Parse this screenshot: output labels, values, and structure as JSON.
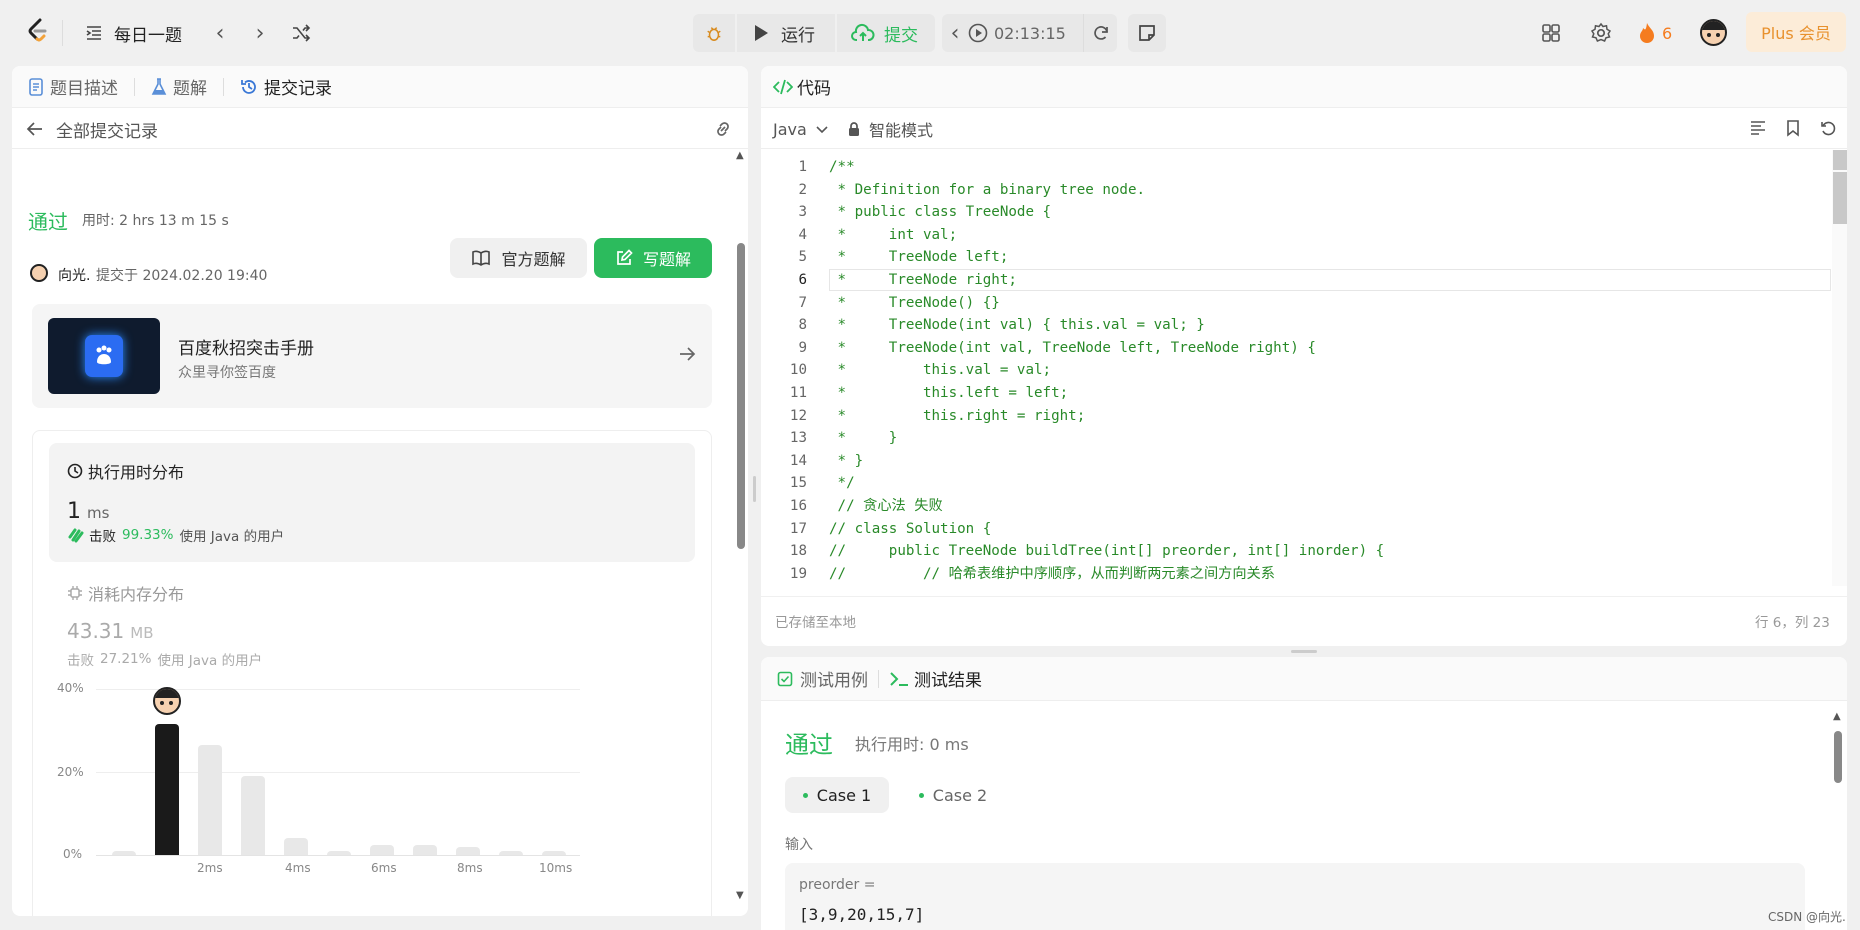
{
  "topbar": {
    "daily_label": "每日一题",
    "run_label": "运行",
    "submit_label": "提交",
    "timer": "02:13:15",
    "streak": "6",
    "plus_label": "Plus 会员"
  },
  "left": {
    "tabs": [
      "题目描述",
      "题解",
      "提交记录"
    ],
    "back_label": "全部提交记录",
    "status": "通过",
    "duration": "用时: 2 hrs 13 m 15 s",
    "user": "向光.",
    "submitted_at": "提交于 2024.02.20 19:40",
    "official_btn": "官方题解",
    "write_btn": "写题解",
    "ad_title": "百度秋招突击手册",
    "ad_sub": "众里寻你签百度",
    "runtime": {
      "title": "执行用时分布",
      "value": "1",
      "unit": "ms",
      "beat_prefix": "击败",
      "beat_pct": "99.33%",
      "beat_suffix": "使用 Java 的用户"
    },
    "memory": {
      "title": "消耗内存分布",
      "value": "43.31",
      "unit": "MB",
      "beat_prefix": "击败",
      "beat_pct": "27.21%",
      "beat_suffix": "使用 Java 的用户"
    }
  },
  "chart_data": {
    "type": "bar",
    "yticks": [
      "40%",
      "20%",
      "0%"
    ],
    "xticks": [
      "2ms",
      "4ms",
      "6ms",
      "8ms",
      "10ms"
    ],
    "ylim": [
      0,
      40
    ],
    "values": [
      1,
      31.5,
      26.5,
      19,
      4,
      1,
      2.5,
      2.5,
      2,
      1,
      1
    ],
    "highlight_index": 1,
    "colors": {
      "bar": "#e8e8e8",
      "highlight": "#1a1a1a"
    }
  },
  "editor": {
    "tab_label": "代码",
    "language": "Java",
    "mode": "智能模式",
    "saved": "已存储至本地",
    "cursor": "行 6，列 23",
    "lines": [
      "/**",
      " * Definition for a binary tree node.",
      " * public class TreeNode {",
      " *     int val;",
      " *     TreeNode left;",
      " *     TreeNode right;",
      " *     TreeNode() {}",
      " *     TreeNode(int val) { this.val = val; }",
      " *     TreeNode(int val, TreeNode left, TreeNode right) {",
      " *         this.val = val;",
      " *         this.left = left;",
      " *         this.right = right;",
      " *     }",
      " * }",
      " */",
      " // 贪心法 失败",
      "// class Solution {",
      "//     public TreeNode buildTree(int[] preorder, int[] inorder) {",
      "//         // 哈希表维护中序顺序，从而判断两元素之间方向关系"
    ],
    "line_numbers": [
      "1",
      "2",
      "3",
      "4",
      "5",
      "6",
      "7",
      "8",
      "9",
      "10",
      "11",
      "12",
      "13",
      "14",
      "15",
      "16",
      "17",
      "18",
      "19"
    ]
  },
  "result": {
    "tab_cases": "测试用例",
    "tab_result": "测试结果",
    "status": "通过",
    "time": "执行用时: 0 ms",
    "case1": "Case 1",
    "case2": "Case 2",
    "input_label": "输入",
    "var_label": "preorder =",
    "var_value": "[3,9,20,15,7]"
  },
  "watermark": "CSDN @向光."
}
